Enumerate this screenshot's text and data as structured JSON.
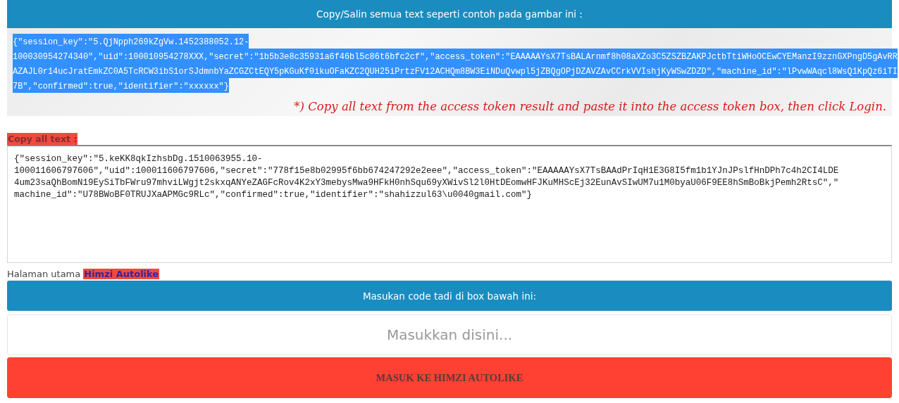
{
  "header": {
    "title": "Copy/Salin semua text seperti contoh pada gambar ini :"
  },
  "example": {
    "lines": [
      "{\"session_key\":\"5.QjNpph269kZgVw.1452388052.12-",
      "100030954274340\",\"uid\":100010954278XXX,\"secret\":\"1b5b3e8c35931a6f46bl5c86t6bfc2cf\",\"access_token\":\"EAAAAAYsX7TsBALArnmf8h08aXZo3C5ZSZBZAKPJctbTtiWHoOCEwCYEManzI9zznGXPngD5gAvRR",
      "AZAJL0r14ucJratEmkZC0A5TcRCW3ibS1orSJdmnbYaZCGZCtEQY5pKGuKf0ikuOFaKZC2QUH25iPrtzFV12ACHQm8BW3EiNDuQvwpl5jZBQgOPjDZAVZAvCCrkVVIshjKyWSwZDZD\",\"machine_id\":\"lPvwWAqcl8WsQ1KpQz6iTI",
      "7B\",\"confirmed\":true,\"identifier\":\"xxxxxx\"}"
    ],
    "note": "*) Copy all text from the access token result and paste it into the access token box, then click Login."
  },
  "copy_label": "Copy all text :",
  "token_box": {
    "lines": [
      "{\"session_key\":\"5.keKK8qkIzhsbDg.1510063955.10-",
      "100011606797606\",\"uid\":100011606797606,\"secret\":\"778f15e8b02995f6bb674247292e2eee\",\"access_token\":\"EAAAAAYsX7TsBAAdPrIqH1E3G8I5fm1b1YJnJPslfHnDPh7c4h2CI4LDE",
      "4um23saQhBomN19EySiTbFWru97mhviLWgjt2skxqANYeZAGFcRov4K2xY3mebysMwa9HFkH0nhSqu69yXWivSl2l0HtDEomwHFJKuMHScEj32EunAvSIwUM7u1M0byaU06F9EE8hSmBoBkjPemh2RtsC\",\"",
      "machine_id\":\"U78BWoBF0TRUJXaAPMGc9RLc\",\"confirmed\":true,\"identifier\":\"shahizzul63\\u0040gmail.com\"}"
    ]
  },
  "home": {
    "text": "Halaman utama",
    "link": "Himzi Autolike"
  },
  "code_bar": {
    "title": "Masukan code tadi di box bawah ini:"
  },
  "code_field": {
    "placeholder": "Masukkan disini..."
  },
  "submit": {
    "label": "MASUK KE HIMZI AUTOLIKE"
  }
}
